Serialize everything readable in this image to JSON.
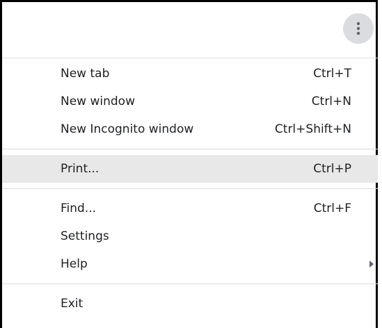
{
  "menu_button": {
    "icon": "more-vert-icon"
  },
  "group1": [
    {
      "label": "New tab",
      "shortcut": "Ctrl+T"
    },
    {
      "label": "New window",
      "shortcut": "Ctrl+N"
    },
    {
      "label": "New Incognito window",
      "shortcut": "Ctrl+Shift+N"
    }
  ],
  "group2": [
    {
      "label": "Print...",
      "shortcut": "Ctrl+P",
      "highlighted": true
    }
  ],
  "group3": [
    {
      "label": "Find...",
      "shortcut": "Ctrl+F"
    },
    {
      "label": "Settings"
    },
    {
      "label": "Help",
      "has_submenu": true
    }
  ],
  "group4": [
    {
      "label": "Exit"
    }
  ],
  "colors": {
    "highlight": "#e8e8e8",
    "menu_button_bg": "#dadce0",
    "separator": "#dcdcdc"
  }
}
